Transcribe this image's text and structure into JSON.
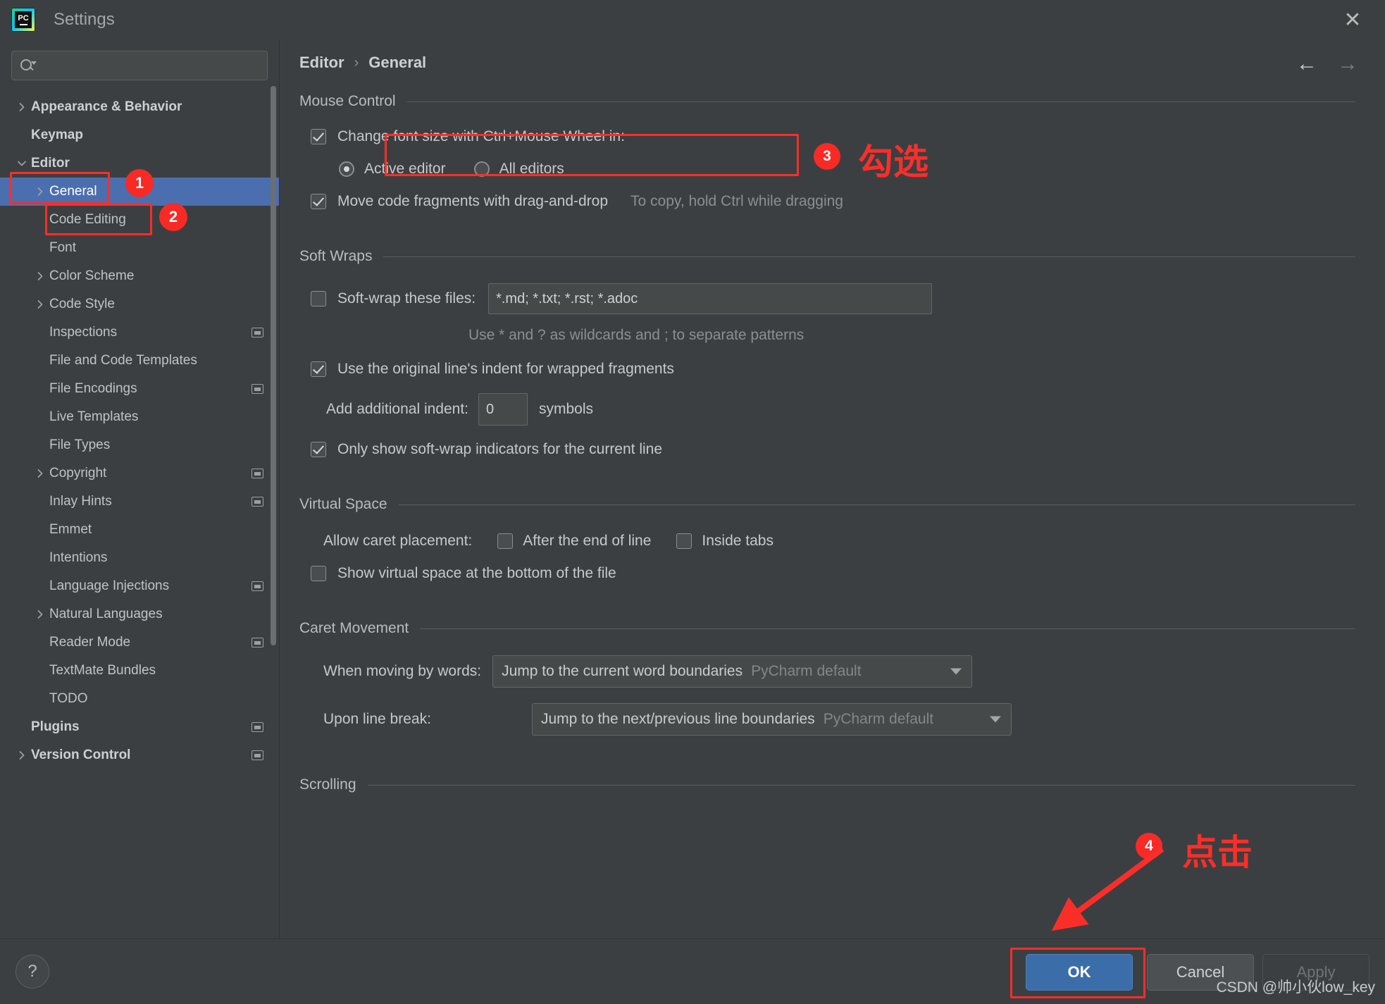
{
  "window": {
    "title": "Settings",
    "logo_text": "PC",
    "close_icon": "✕"
  },
  "search": {
    "value": "",
    "placeholder": ""
  },
  "sidebar": {
    "items": [
      {
        "label": "Appearance & Behavior",
        "level": 0,
        "chevron": "right",
        "bold": true,
        "badge": false,
        "selected": false
      },
      {
        "label": "Keymap",
        "level": 0,
        "chevron": "none",
        "bold": true,
        "badge": false,
        "selected": false
      },
      {
        "label": "Editor",
        "level": 0,
        "chevron": "down",
        "bold": true,
        "badge": false,
        "selected": false
      },
      {
        "label": "General",
        "level": 1,
        "chevron": "right",
        "bold": false,
        "badge": false,
        "selected": true
      },
      {
        "label": "Code Editing",
        "level": 1,
        "chevron": "none",
        "bold": false,
        "badge": false,
        "selected": false
      },
      {
        "label": "Font",
        "level": 1,
        "chevron": "none",
        "bold": false,
        "badge": false,
        "selected": false
      },
      {
        "label": "Color Scheme",
        "level": 1,
        "chevron": "right",
        "bold": false,
        "badge": false,
        "selected": false
      },
      {
        "label": "Code Style",
        "level": 1,
        "chevron": "right",
        "bold": false,
        "badge": false,
        "selected": false
      },
      {
        "label": "Inspections",
        "level": 1,
        "chevron": "none",
        "bold": false,
        "badge": true,
        "selected": false
      },
      {
        "label": "File and Code Templates",
        "level": 1,
        "chevron": "none",
        "bold": false,
        "badge": false,
        "selected": false
      },
      {
        "label": "File Encodings",
        "level": 1,
        "chevron": "none",
        "bold": false,
        "badge": true,
        "selected": false
      },
      {
        "label": "Live Templates",
        "level": 1,
        "chevron": "none",
        "bold": false,
        "badge": false,
        "selected": false
      },
      {
        "label": "File Types",
        "level": 1,
        "chevron": "none",
        "bold": false,
        "badge": false,
        "selected": false
      },
      {
        "label": "Copyright",
        "level": 1,
        "chevron": "right",
        "bold": false,
        "badge": true,
        "selected": false
      },
      {
        "label": "Inlay Hints",
        "level": 1,
        "chevron": "none",
        "bold": false,
        "badge": true,
        "selected": false
      },
      {
        "label": "Emmet",
        "level": 1,
        "chevron": "none",
        "bold": false,
        "badge": false,
        "selected": false
      },
      {
        "label": "Intentions",
        "level": 1,
        "chevron": "none",
        "bold": false,
        "badge": false,
        "selected": false
      },
      {
        "label": "Language Injections",
        "level": 1,
        "chevron": "none",
        "bold": false,
        "badge": true,
        "selected": false
      },
      {
        "label": "Natural Languages",
        "level": 1,
        "chevron": "right",
        "bold": false,
        "badge": false,
        "selected": false
      },
      {
        "label": "Reader Mode",
        "level": 1,
        "chevron": "none",
        "bold": false,
        "badge": true,
        "selected": false
      },
      {
        "label": "TextMate Bundles",
        "level": 1,
        "chevron": "none",
        "bold": false,
        "badge": false,
        "selected": false
      },
      {
        "label": "TODO",
        "level": 1,
        "chevron": "none",
        "bold": false,
        "badge": false,
        "selected": false
      },
      {
        "label": "Plugins",
        "level": 0,
        "chevron": "none",
        "bold": true,
        "badge": true,
        "selected": false
      },
      {
        "label": "Version Control",
        "level": 0,
        "chevron": "right",
        "bold": true,
        "badge": true,
        "selected": false
      }
    ]
  },
  "breadcrumb": {
    "root": "Editor",
    "separator": "›",
    "leaf": "General"
  },
  "nav": {
    "back_icon": "←",
    "forward_icon": "→"
  },
  "sections": {
    "mouse_control": {
      "title": "Mouse Control",
      "change_font_size_label": "Change font size with Ctrl+Mouse Wheel in:",
      "change_font_size_checked": true,
      "scope_active_label": "Active editor",
      "scope_all_label": "All editors",
      "scope_selected": "Active editor",
      "drag_drop_label": "Move code fragments with drag-and-drop",
      "drag_drop_checked": true,
      "drag_drop_hint": "To copy, hold Ctrl while dragging"
    },
    "soft_wraps": {
      "title": "Soft Wraps",
      "softwrap_files_label": "Soft-wrap these files:",
      "softwrap_files_checked": false,
      "softwrap_files_value": "*.md; *.txt; *.rst; *.adoc",
      "wildcard_hint": "Use * and ? as wildcards and ; to separate patterns",
      "original_indent_label": "Use the original line's indent for wrapped fragments",
      "original_indent_checked": true,
      "additional_indent_label": "Add additional indent:",
      "additional_indent_value": "0",
      "additional_indent_suffix": "symbols",
      "only_current_line_label": "Only show soft-wrap indicators for the current line",
      "only_current_line_checked": true
    },
    "virtual_space": {
      "title": "Virtual Space",
      "caret_placement_label": "Allow caret placement:",
      "after_end_label": "After the end of line",
      "after_end_checked": false,
      "inside_tabs_label": "Inside tabs",
      "inside_tabs_checked": false,
      "show_virtual_space_label": "Show virtual space at the bottom of the file",
      "show_virtual_space_checked": false
    },
    "caret_movement": {
      "title": "Caret Movement",
      "moving_by_words_label": "When moving by words:",
      "moving_by_words_value": "Jump to the current word boundaries",
      "moving_by_words_default": "PyCharm default",
      "upon_line_break_label": "Upon line break:",
      "upon_line_break_value": "Jump to the next/previous line boundaries",
      "upon_line_break_default": "PyCharm default"
    },
    "scrolling": {
      "title": "Scrolling"
    }
  },
  "footer": {
    "help_label": "?",
    "ok_label": "OK",
    "cancel_label": "Cancel",
    "apply_label": "Apply",
    "watermark": "CSDN @帅小伙low_key"
  },
  "annotations": {
    "badge1": "1",
    "badge2": "2",
    "badge3": "3",
    "badge4": "4",
    "text3": "勾选",
    "text4": "点击",
    "color": "#fa2e29"
  }
}
